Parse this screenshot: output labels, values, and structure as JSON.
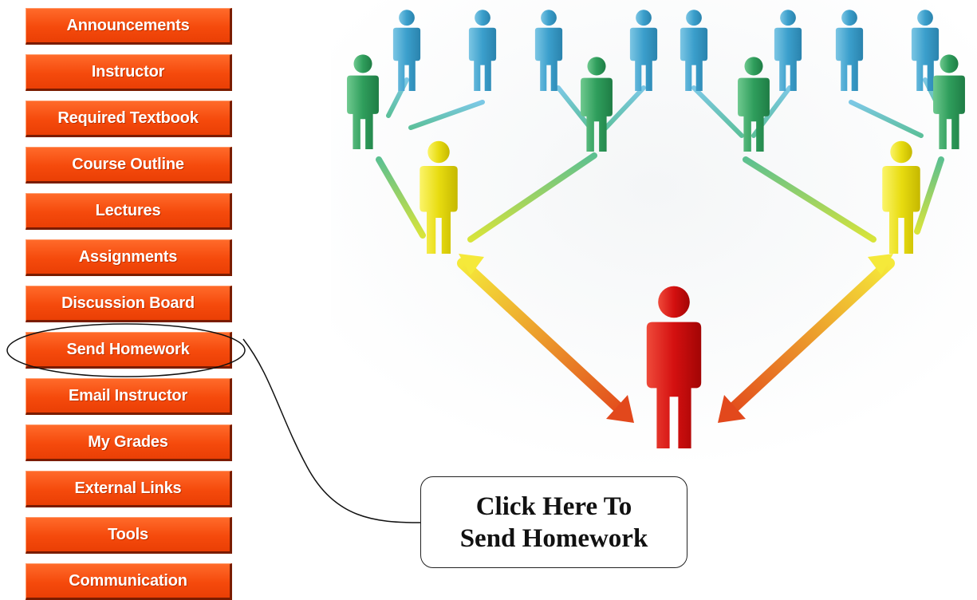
{
  "nav": {
    "items": [
      {
        "label": "Announcements"
      },
      {
        "label": "Instructor"
      },
      {
        "label": "Required Textbook"
      },
      {
        "label": "Course Outline"
      },
      {
        "label": "Lectures"
      },
      {
        "label": "Assignments"
      },
      {
        "label": "Discussion Board"
      },
      {
        "label": "Send Homework"
      },
      {
        "label": "Email Instructor"
      },
      {
        "label": "My Grades"
      },
      {
        "label": "External Links"
      },
      {
        "label": "Tools"
      },
      {
        "label": "Communication"
      }
    ],
    "highlighted_item": "Send Homework"
  },
  "callout": {
    "line1": "Click Here To",
    "line2": "Send Homework"
  },
  "colors": {
    "button": "#f54a0c",
    "button_border": "#7a1c00",
    "button_text": "#ffffff",
    "figure_top": "#4aa8d0",
    "figure_second": "#3aa868",
    "figure_third": "#e6e014",
    "figure_leader": "#d81010"
  },
  "illustration": {
    "description_icon": "people-network-hierarchy-icon"
  }
}
